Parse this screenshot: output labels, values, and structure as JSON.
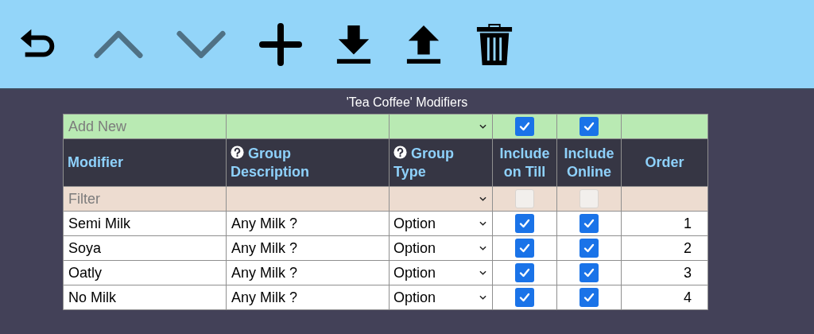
{
  "toolbar": [
    {
      "kind": "undo",
      "disabled": false
    },
    {
      "kind": "up",
      "disabled": true
    },
    {
      "kind": "down",
      "disabled": true
    },
    {
      "kind": "add",
      "disabled": false
    },
    {
      "kind": "download",
      "disabled": false
    },
    {
      "kind": "upload",
      "disabled": false
    },
    {
      "kind": "delete",
      "disabled": false
    }
  ],
  "title": "'Tea Coffee' Modifiers",
  "add_new": {
    "placeholder": "Add New",
    "include_on_till": true,
    "include_online": true
  },
  "columns": [
    {
      "label": "Modifier",
      "help": false
    },
    {
      "label": "Group Description",
      "help": true
    },
    {
      "label": "Group Type",
      "help": true
    },
    {
      "label": "Include on Till",
      "help": false
    },
    {
      "label": "Include Online",
      "help": false
    },
    {
      "label": "Order",
      "help": false
    }
  ],
  "filter": {
    "placeholder": "Filter",
    "include_on_till": false,
    "include_online": false
  },
  "rows": [
    {
      "modifier": "Semi Milk",
      "group_description": "Any Milk ?",
      "group_type": "Option",
      "include_on_till": true,
      "include_online": true,
      "order": "1"
    },
    {
      "modifier": "Soya",
      "group_description": "Any Milk ?",
      "group_type": "Option",
      "include_on_till": true,
      "include_online": true,
      "order": "2"
    },
    {
      "modifier": "Oatly",
      "group_description": "Any Milk ?",
      "group_type": "Option",
      "include_on_till": true,
      "include_online": true,
      "order": "3"
    },
    {
      "modifier": "No Milk",
      "group_description": "Any Milk ?",
      "group_type": "Option",
      "include_on_till": true,
      "include_online": true,
      "order": "4"
    }
  ]
}
